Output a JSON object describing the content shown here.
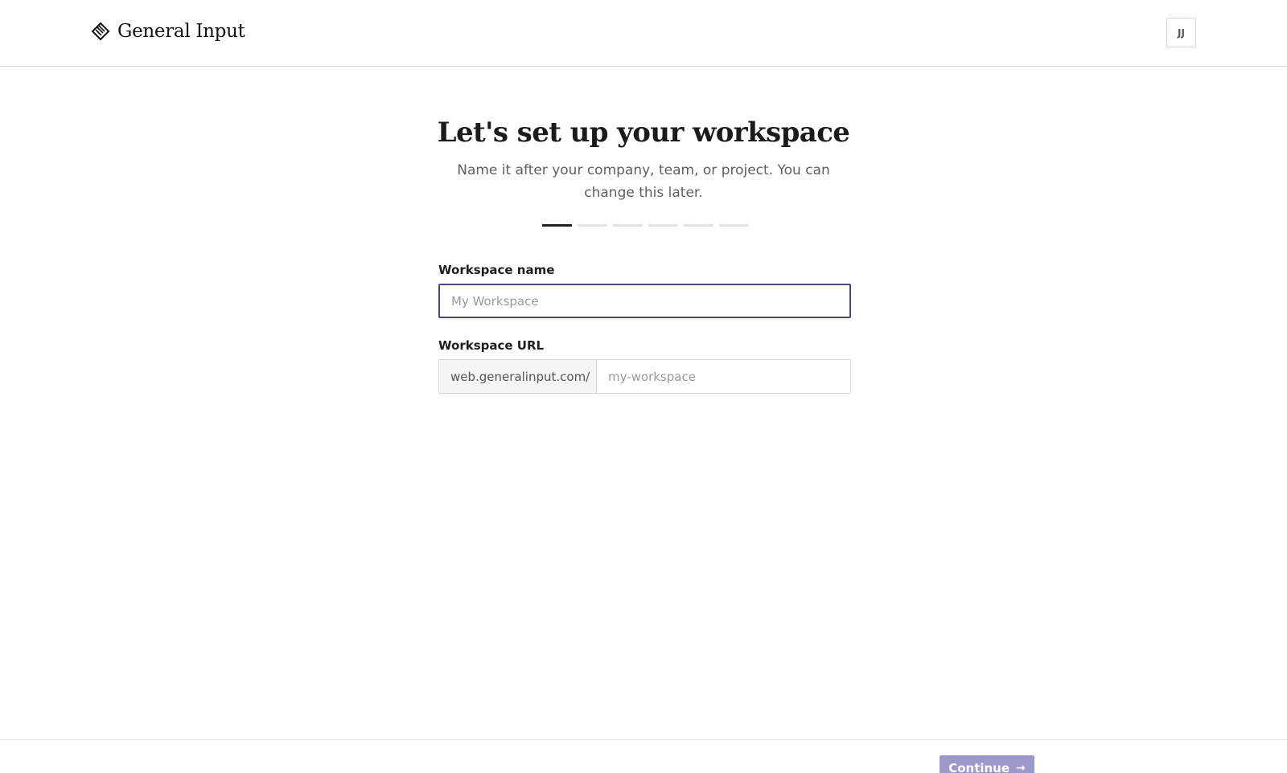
{
  "header": {
    "brand_name": "General Input",
    "logo_icon": "stacked-diamond-logo-icon",
    "avatar_initials": "JJ"
  },
  "main": {
    "title": "Let's set up your workspace",
    "subtitle": "Name it after your company, team, or project. You can change this later.",
    "progress": {
      "current_step": 1,
      "total_steps": 6
    },
    "workspace_name": {
      "label": "Workspace name",
      "placeholder": "My Workspace",
      "value": ""
    },
    "workspace_url": {
      "label": "Workspace URL",
      "prefix": "web.generalinput.com/",
      "placeholder": "my-workspace",
      "value": ""
    }
  },
  "footer": {
    "continue_label": "Continue",
    "continue_icon": "arrow-right-icon",
    "continue_arrow": "→"
  },
  "colors": {
    "accent_button": "#9c98c9",
    "focus_border": "#4a4a7a",
    "active_step": "#222222",
    "inactive_step": "#e3e3e3"
  }
}
